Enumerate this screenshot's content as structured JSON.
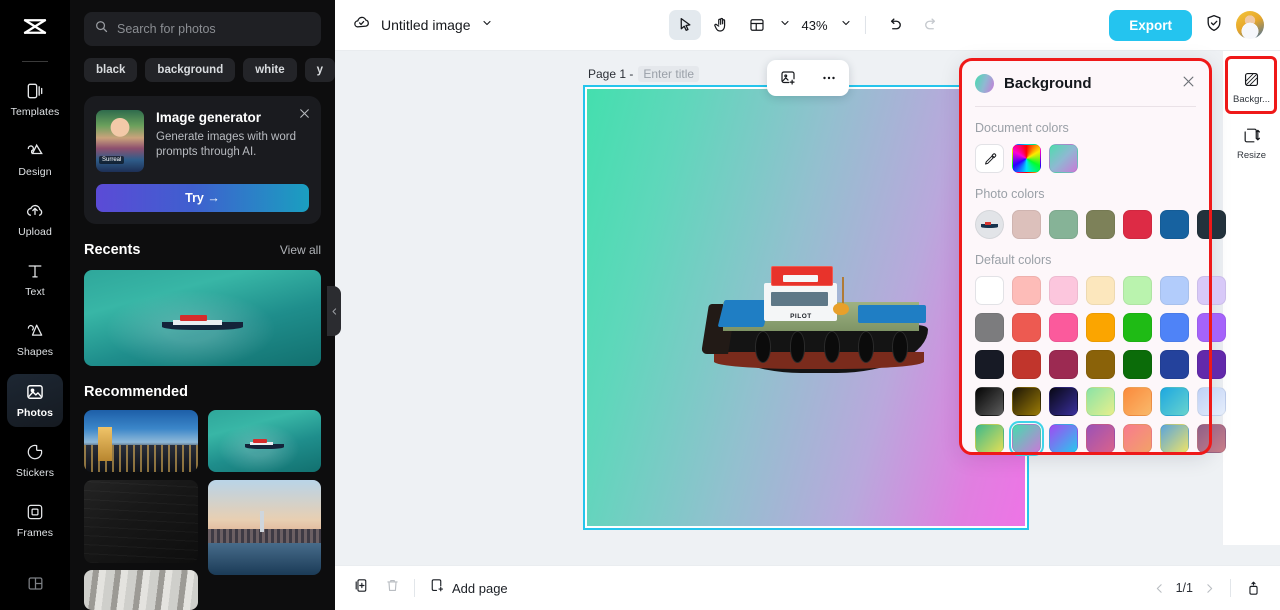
{
  "sidebar": {
    "logo_icon": "capcut-logo-icon",
    "items": [
      {
        "label": "Templates",
        "icon": "templates-icon",
        "active": false
      },
      {
        "label": "Design",
        "icon": "design-icon",
        "active": false
      },
      {
        "label": "Upload",
        "icon": "upload-cloud-icon",
        "active": false
      },
      {
        "label": "Text",
        "icon": "text-icon",
        "active": false
      },
      {
        "label": "Shapes",
        "icon": "shapes-icon",
        "active": false
      },
      {
        "label": "Photos",
        "icon": "photos-icon",
        "active": true
      },
      {
        "label": "Stickers",
        "icon": "stickers-icon",
        "active": false
      },
      {
        "label": "Frames",
        "icon": "frames-icon",
        "active": false
      }
    ]
  },
  "photos_panel": {
    "search": {
      "placeholder": "Search for photos",
      "value": "",
      "icon": "search-icon"
    },
    "tags": [
      "black",
      "background",
      "white",
      "y"
    ],
    "promo": {
      "title": "Image generator",
      "description": "Generate images with word prompts through AI.",
      "thumb_badge": "Surreal",
      "cta_label": "Try →",
      "close_icon": "close-icon"
    },
    "recents": {
      "title": "Recents",
      "view_all": "View all"
    },
    "recommended": {
      "title": "Recommended"
    }
  },
  "topbar": {
    "cloud_icon": "cloud-check-icon",
    "document_title": "Untitled image",
    "title_caret_icon": "chevron-down-icon",
    "tools": [
      {
        "name": "select-tool",
        "icon": "cursor-arrow-icon",
        "selected": true
      },
      {
        "name": "hand-tool",
        "icon": "hand-icon",
        "selected": false
      },
      {
        "name": "layout-tool",
        "icon": "layout-grid-icon",
        "selected": false
      }
    ],
    "zoom_level": "43%",
    "zoom_caret_icon": "chevron-down-icon",
    "undo_icon": "undo-icon",
    "redo_icon": "redo-icon",
    "export_label": "Export",
    "shield_icon": "shield-check-icon",
    "avatar_name": "avatar"
  },
  "canvas": {
    "page_prefix": "Page 1 -",
    "title_placeholder": "Enter title",
    "float_tools": [
      {
        "name": "add-image-button",
        "icon": "image-plus-icon"
      },
      {
        "name": "more-options-button",
        "icon": "ellipsis-icon"
      }
    ],
    "selection_color": "#25c5ec",
    "gradient_start": "#44dfae",
    "gradient_end": "#ee74e6",
    "artwork_label": "PILOT"
  },
  "background_panel": {
    "title": "Background",
    "close_icon": "close-icon",
    "sections": [
      {
        "label": "Document colors"
      },
      {
        "label": "Photo colors"
      },
      {
        "label": "Default colors"
      }
    ],
    "document_colors": [
      {
        "name": "eyedropper-tool",
        "type": "eyedropper"
      },
      {
        "name": "color-wheel-swatch",
        "type": "wheel"
      },
      {
        "name": "document-gradient-swatch",
        "type": "gradient",
        "css": "linear-gradient(135deg,#4fdcae,#8fb8d2,#c97ad8)"
      }
    ],
    "photo_colors": [
      {
        "name": "photo-source-thumb",
        "type": "photo"
      },
      {
        "color": "#dcc0bb"
      },
      {
        "color": "#86b397"
      },
      {
        "color": "#7d8159"
      },
      {
        "color": "#dd2b45"
      },
      {
        "color": "#1762a0"
      },
      {
        "color": "#23323c"
      }
    ],
    "default_colors_rows": [
      [
        {
          "color": "#ffffff"
        },
        {
          "color": "#fdbcb8"
        },
        {
          "color": "#fcc6dd"
        },
        {
          "color": "#fce7bd"
        },
        {
          "color": "#baf3ae"
        },
        {
          "color": "#b2ccfb"
        },
        {
          "color": "#d8c9f8"
        }
      ],
      [
        {
          "color": "#7c7c7e"
        },
        {
          "color": "#ed5a51"
        },
        {
          "color": "#fb5a9c"
        },
        {
          "color": "#fba500"
        },
        {
          "color": "#1fbb15"
        },
        {
          "color": "#4f83f7"
        },
        {
          "color": "#a563fa"
        }
      ],
      [
        {
          "color": "#171a25"
        },
        {
          "color": "#c1352c"
        },
        {
          "color": "#9c2a52"
        },
        {
          "color": "#8a6209"
        },
        {
          "color": "#0b6c09"
        },
        {
          "color": "#24429c"
        },
        {
          "color": "#6229ab"
        }
      ],
      [
        {
          "color": "#333333",
          "css": "linear-gradient(135deg,#050505,#5d5d5d)"
        },
        {
          "color": "#6a5300",
          "css": "linear-gradient(135deg,#1d1605,#9a7a07)"
        },
        {
          "color": "#211c5c",
          "css": "linear-gradient(135deg,#080815,#3a2f9c)"
        },
        {
          "color": "#9fe58a",
          "css": "linear-gradient(135deg,#8be3a6,#e7ef8c)"
        },
        {
          "color": "#f79b4a",
          "css": "linear-gradient(135deg,#fb8a3c,#f9b96b)"
        },
        {
          "color": "#29a8d8",
          "css": "linear-gradient(135deg,#1ea8e0,#68d3ce)"
        },
        {
          "color": "#c6d9f7",
          "css": "linear-gradient(135deg,#bed0f6,#e6eefb)"
        }
      ],
      [
        {
          "color": "#6fbe7a",
          "css": "linear-gradient(135deg,#3fb98b,#e2de55)"
        },
        {
          "color": "#6fd5c1",
          "css": "linear-gradient(135deg,#45dcae,#c87ad8)",
          "selected": true
        },
        {
          "color": "#8c57f5",
          "css": "linear-gradient(135deg,#a04bf2,#2bc6ee)"
        },
        {
          "color": "#b05fb0",
          "css": "linear-gradient(135deg,#9b52b6,#d9628c)"
        },
        {
          "color": "#f5708b",
          "css": "linear-gradient(135deg,#f87b8e,#f2a168)"
        },
        {
          "color": "#67aad8",
          "css": "linear-gradient(135deg,#5aa5dc,#ece26a)"
        },
        {
          "color": "#a36c93",
          "css": "linear-gradient(135deg,#8f5f88,#c97e88)"
        }
      ]
    ],
    "highlight_color": "#ef1919"
  },
  "right_rail": {
    "items": [
      {
        "label": "Backgr...",
        "icon": "background-icon",
        "highlighted": true
      },
      {
        "label": "Resize",
        "icon": "resize-icon",
        "highlighted": false
      }
    ]
  },
  "bottombar": {
    "duplicate_icon": "duplicate-page-icon",
    "delete_icon": "trash-icon",
    "add_page_icon": "add-page-icon",
    "add_page_label": "Add page",
    "prev_icon": "chevron-left-icon",
    "next_icon": "chevron-right-icon",
    "page_indicator": "1/1",
    "export_panel_icon": "panel-toggle-icon"
  }
}
